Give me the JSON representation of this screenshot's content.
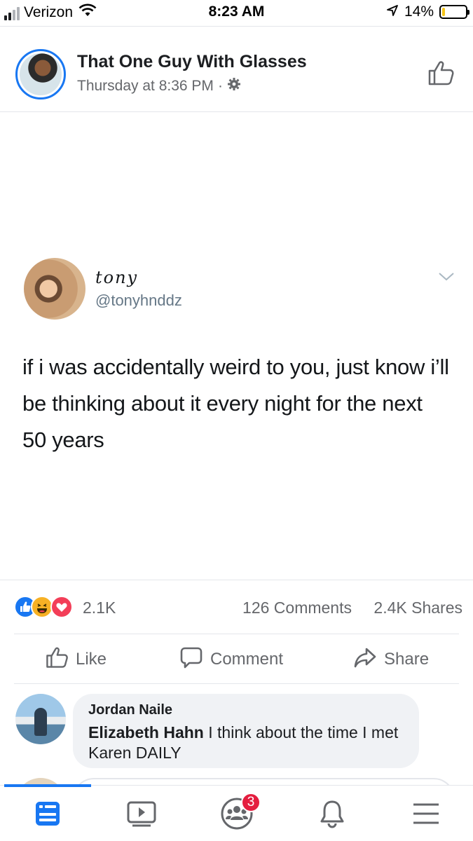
{
  "status_bar": {
    "carrier": "Verizon",
    "time": "8:23 AM",
    "battery_percent": "14%",
    "battery_level": 0.14,
    "signal_bars": 2
  },
  "post": {
    "page_name": "That One Guy With Glasses",
    "timestamp": "Thursday at 8:36 PM",
    "separator": "·"
  },
  "tweet": {
    "name": "tony",
    "handle": "@tonyhnddz",
    "text": "if i was accidentally weird to you, just know i’ll be thinking about it every night for the next 50 years"
  },
  "reactions": {
    "types": [
      "like",
      "haha",
      "love"
    ],
    "count": "2.1K",
    "comments": "126 Comments",
    "shares": "2.4K Shares"
  },
  "actions": {
    "like_label": "Like",
    "comment_label": "Comment",
    "share_label": "Share"
  },
  "comment": {
    "author": "Jordan Naile",
    "mention": "Elizabeth Hahn",
    "text": " I think about the time I met Karen DAILY"
  },
  "tab_bar": {
    "items": [
      "news-feed",
      "watch",
      "groups",
      "notifications",
      "menu"
    ],
    "active": "news-feed",
    "groups_badge": "3"
  },
  "colors": {
    "accent": "#1877f2",
    "badge": "#e41e3f",
    "secondary_text": "#65676b"
  }
}
